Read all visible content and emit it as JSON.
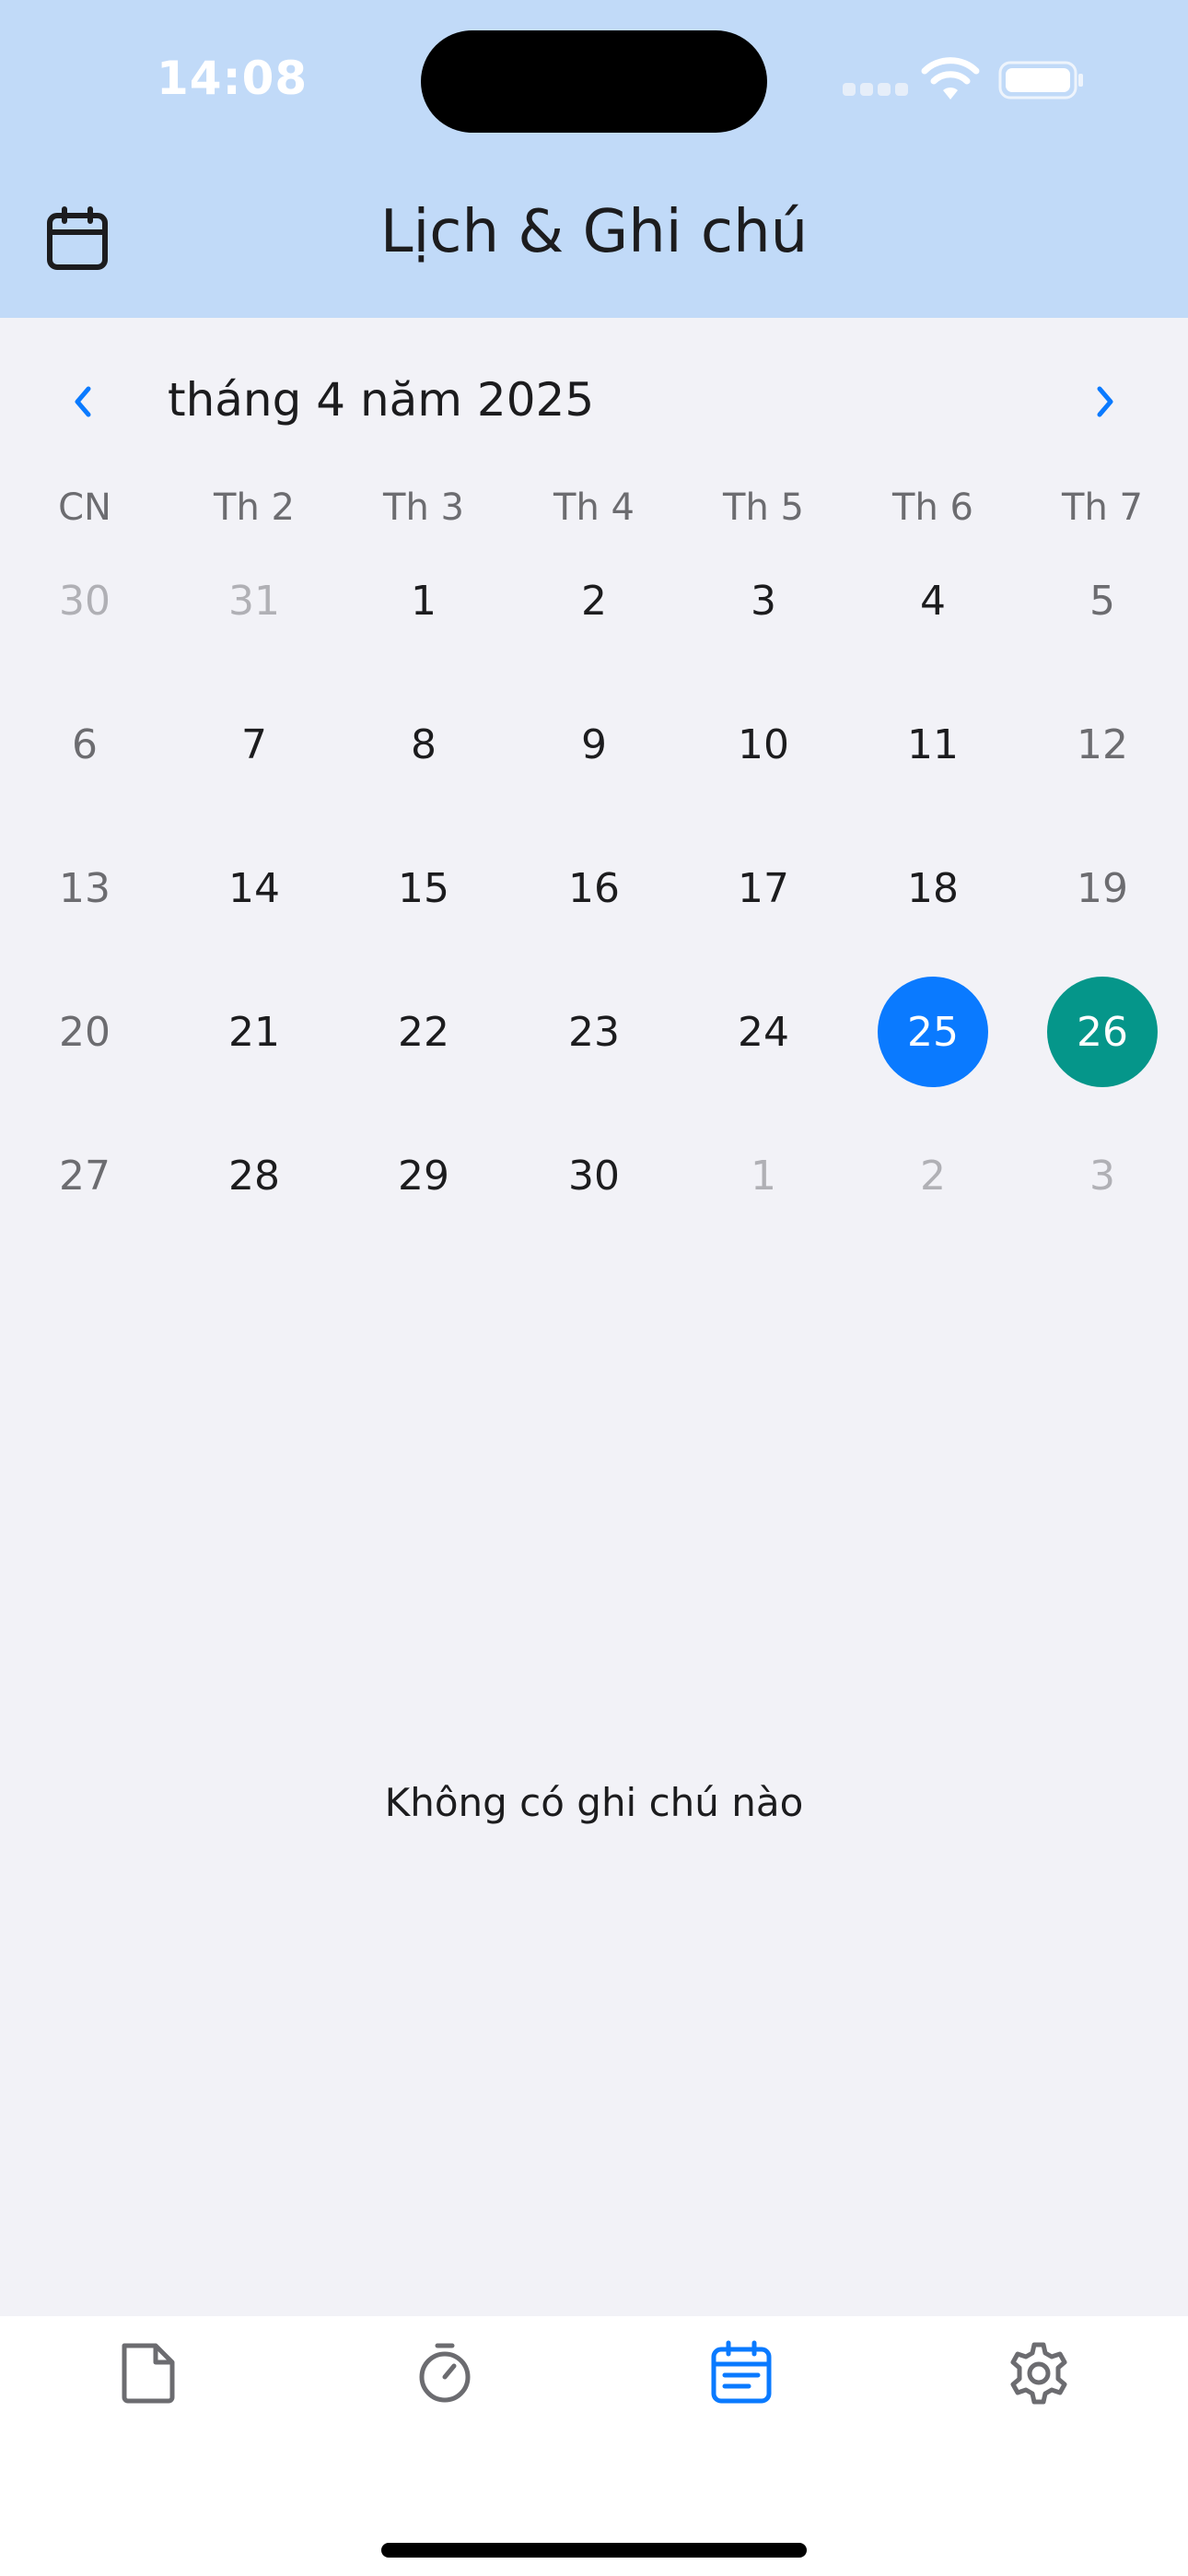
{
  "status_bar": {
    "time": "14:08"
  },
  "header": {
    "title": "Lịch & Ghi chú",
    "icon": "calendar-icon"
  },
  "calendar": {
    "month_label": "tháng 4 năm 2025",
    "prev_icon": "chevron-left-icon",
    "next_icon": "chevron-right-icon",
    "weekdays": [
      "CN",
      "Th 2",
      "Th 3",
      "Th 4",
      "Th 5",
      "Th 6",
      "Th 7"
    ],
    "weeks": [
      [
        "30",
        "31",
        "1",
        "2",
        "3",
        "4",
        "5"
      ],
      [
        "6",
        "7",
        "8",
        "9",
        "10",
        "11",
        "12"
      ],
      [
        "13",
        "14",
        "15",
        "16",
        "17",
        "18",
        "19"
      ],
      [
        "20",
        "21",
        "22",
        "23",
        "24",
        "25",
        "26"
      ],
      [
        "27",
        "28",
        "29",
        "30",
        "1",
        "2",
        "3"
      ]
    ],
    "selected_day": "25",
    "today": "26",
    "selected_color": "#0a7aff",
    "today_color": "#05968a"
  },
  "notes": {
    "empty_text": "Không có ghi chú nào"
  },
  "tab_bar": {
    "tabs": [
      {
        "name": "notes",
        "icon": "note-icon",
        "active": false
      },
      {
        "name": "timer",
        "icon": "stopwatch-icon",
        "active": false
      },
      {
        "name": "calendar",
        "icon": "calendar-list-icon",
        "active": true
      },
      {
        "name": "settings",
        "icon": "gear-icon",
        "active": false
      }
    ],
    "active_color": "#0a7aff",
    "inactive_color": "#6c6c70"
  }
}
